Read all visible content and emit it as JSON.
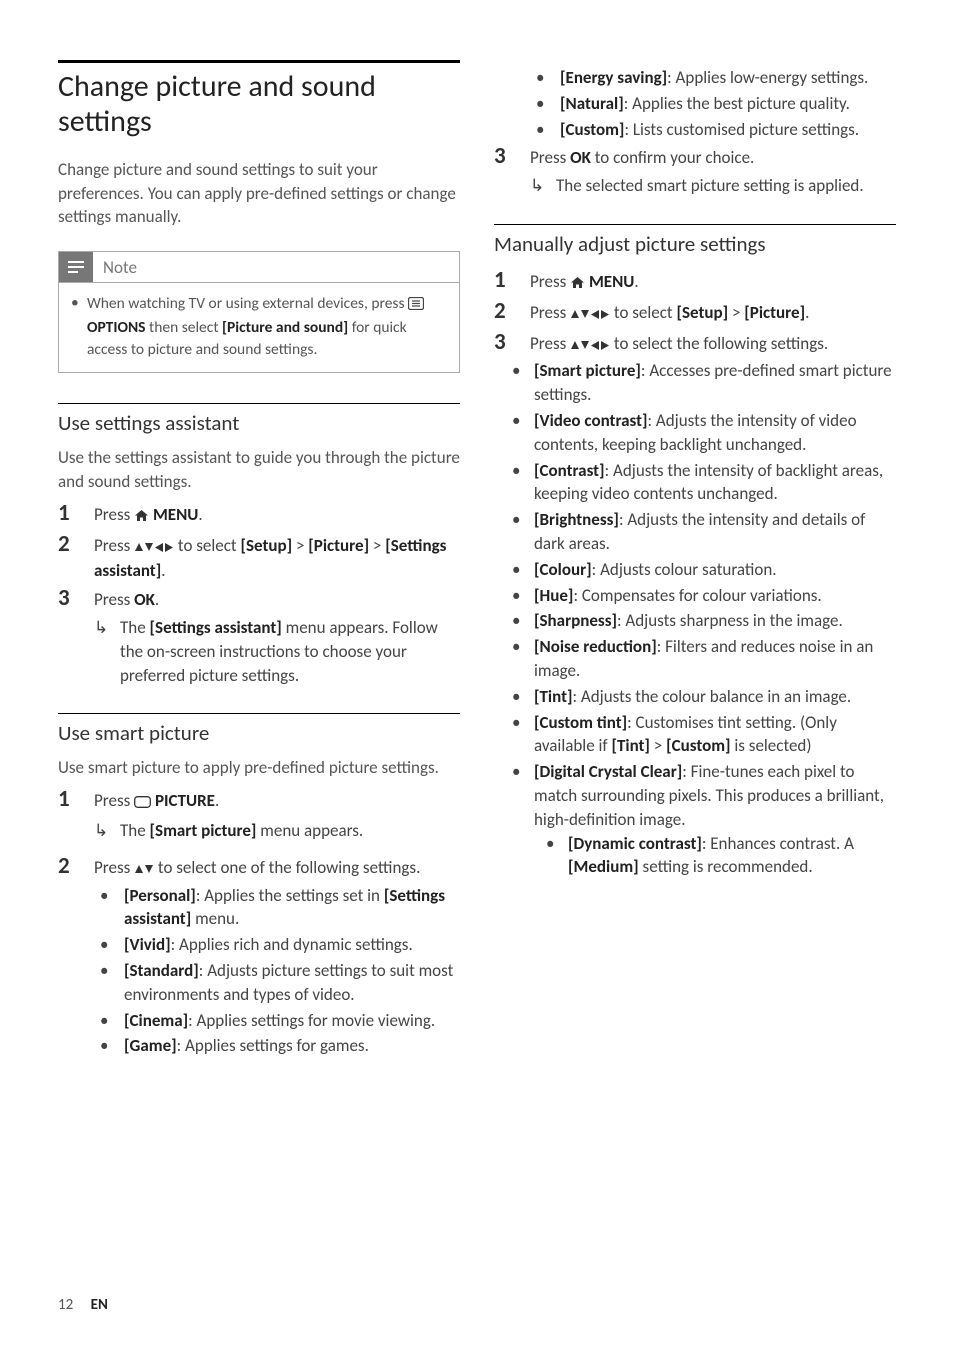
{
  "title": "Change picture and sound settings",
  "intro": "Change picture and sound settings to suit your preferences. You can apply pre-defined settings or change settings manually.",
  "note": {
    "label": "Note",
    "text_pre": "When watching TV or using external devices, press ",
    "options": "OPTIONS",
    "mid": " then select ",
    "bold": "[Picture and sound]",
    "post": " for quick access to picture and sound settings."
  },
  "assist": {
    "heading": "Use settings assistant",
    "intro": "Use the settings assistant to guide you through the picture and sound settings.",
    "step1_pre": "Press ",
    "step1_bold": "MENU",
    "step2_pre": "Press ",
    "step2_mid": " to select ",
    "step2_setup": "[Setup]",
    "step2_gt1": " > ",
    "step2_pic": "[Picture]",
    "step2_gt2": " > ",
    "step2_sa": "[Settings assistant]",
    "step3_pre": "Press ",
    "step3_ok": "OK",
    "step3_res_pre": "The ",
    "step3_res_bold": "[Settings assistant]",
    "step3_res_post": " menu appears. Follow the on-screen instructions to choose your preferred picture settings."
  },
  "smart": {
    "heading": "Use smart picture",
    "intro": "Use smart picture to apply pre-defined picture settings.",
    "s1_pre": "Press ",
    "s1_bold": "PICTURE",
    "s1_res_pre": "The ",
    "s1_res_bold": "[Smart picture]",
    "s1_res_post": " menu appears.",
    "s2_pre": "Press ",
    "s2_post": " to select one of the following settings.",
    "items": [
      {
        "b": "[Personal]",
        "pre": ": Applies the settings set in ",
        "b2": "[Settings assistant]",
        "post": " menu."
      },
      {
        "b": "[Vivid]",
        "t": ": Applies rich and dynamic settings."
      },
      {
        "b": "[Standard]",
        "t": ": Adjusts picture settings to suit most environments and types of video."
      },
      {
        "b": "[Cinema]",
        "t": ": Applies settings for movie viewing."
      },
      {
        "b": "[Game]",
        "t": ": Applies settings for games."
      },
      {
        "b": "[Energy saving]",
        "t": ": Applies low-energy settings."
      },
      {
        "b": "[Natural]",
        "t": ": Applies the best picture quality."
      },
      {
        "b": "[Custom]",
        "t": ": Lists customised picture settings."
      }
    ],
    "s3_pre": "Press ",
    "s3_ok": "OK",
    "s3_post": " to confirm your choice.",
    "s3_res": "The selected smart picture setting is applied."
  },
  "manual": {
    "heading": "Manually adjust picture settings",
    "s1_pre": "Press ",
    "s1_bold": "MENU",
    "s2_pre": "Press ",
    "s2_mid": " to select ",
    "s2_setup": "[Setup]",
    "s2_gt": " > ",
    "s2_pic": "[Picture]",
    "s3_pre": "Press ",
    "s3_post": " to select the following settings.",
    "items": [
      {
        "b": "[Smart picture]",
        "t": ": Accesses pre-defined smart picture settings."
      },
      {
        "b": "[Video contrast]",
        "t": ": Adjusts the intensity of video contents, keeping backlight unchanged."
      },
      {
        "b": "[Contrast]",
        "t": ": Adjusts the intensity of backlight areas, keeping video contents unchanged."
      },
      {
        "b": "[Brightness]",
        "t": ": Adjusts the intensity and details of dark areas."
      },
      {
        "b": "[Colour]",
        "t": ": Adjusts colour saturation."
      },
      {
        "b": "[Hue]",
        "t": ": Compensates for colour variations."
      },
      {
        "b": "[Sharpness]",
        "t": ": Adjusts sharpness in the image."
      },
      {
        "b": "[Noise reduction]",
        "t": ": Filters and reduces noise in an image."
      },
      {
        "b": "[Tint]",
        "t": ": Adjusts the colour balance in an image."
      }
    ],
    "ct_b": "[Custom tint]",
    "ct_pre": ": Customises tint setting. (Only available if ",
    "ct_tint": "[Tint]",
    "ct_gt": " > ",
    "ct_custom": "[Custom]",
    "ct_post": " is selected)",
    "dcc_b": "[Digital Crystal Clear]",
    "dcc_t": ": Fine-tunes each pixel to match surrounding pixels. This produces a brilliant, high-definition image.",
    "dyn_b": "[Dynamic contrast]",
    "dyn_pre": ": Enhances contrast. A ",
    "dyn_med": "[Medium]",
    "dyn_post": " setting is recommended."
  },
  "footer": {
    "page": "12",
    "lang": "EN"
  }
}
